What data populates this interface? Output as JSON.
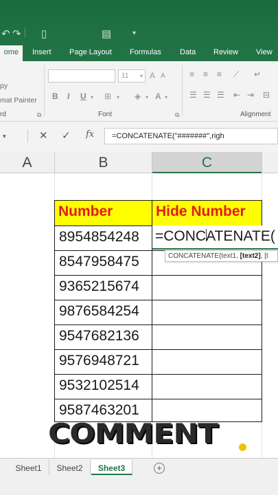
{
  "quick_access": {
    "undo_icon": "undo-icon",
    "redo_icon": "redo-icon",
    "new_icon": "new-document-icon",
    "form_icon": "form-icon",
    "customize_icon": "customize-dropdown-icon"
  },
  "ribbon_tabs": [
    "ome",
    "Insert",
    "Page Layout",
    "Formulas",
    "Data",
    "Review",
    "View"
  ],
  "ribbon": {
    "clipboard_cut": "py",
    "clipboard_format_painter": "mat Painter",
    "clipboard_group_label": "rd",
    "font_size": "11",
    "font_group_label": "Font",
    "alignment_group_label": "Alignment",
    "bold": "B",
    "italic": "I",
    "underline": "U"
  },
  "formula_bar": {
    "formula": "=CONCATENATE(\"#######\",righ"
  },
  "columns": [
    "A",
    "B",
    "C"
  ],
  "table": {
    "headers": [
      "Number",
      "Hide Number"
    ],
    "numbers": [
      "8954854248",
      "8547958475",
      "9365215674",
      "9876584254",
      "9547682136",
      "9576948721",
      "9532102514",
      "9587463201"
    ],
    "active_cell_text": "=CONCATENATE(",
    "tooltip_prefix": "CONCATENATE(text1, ",
    "tooltip_bold": "[text2]",
    "tooltip_suffix": ", [t"
  },
  "overlay_text": "COMMENT",
  "colors": {
    "excel_green": "#217346",
    "header_fill": "#ffff00",
    "header_text": "#e31b1b",
    "comment_dot": "#f2c000"
  },
  "sheets": [
    "Sheet1",
    "Sheet2",
    "Sheet3"
  ],
  "active_sheet": "Sheet3"
}
